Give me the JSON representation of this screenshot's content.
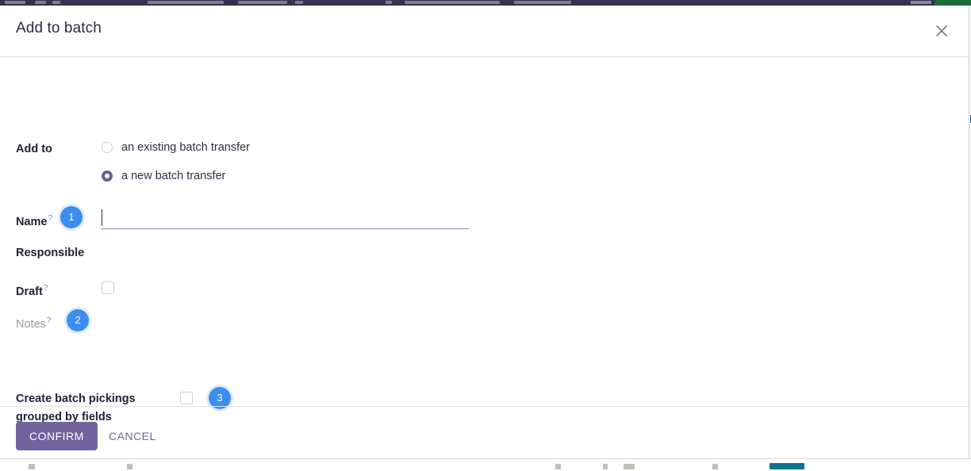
{
  "modal": {
    "title": "Add to batch",
    "close_icon": "close-icon"
  },
  "form": {
    "add_to": {
      "label": "Add to",
      "options": [
        {
          "label": "an existing batch transfer",
          "selected": false
        },
        {
          "label": "a new batch transfer",
          "selected": true
        }
      ]
    },
    "name": {
      "label": "Name",
      "help": "?",
      "value": "",
      "placeholder": ""
    },
    "responsible": {
      "label": "Responsible"
    },
    "draft": {
      "label": "Draft",
      "help": "?",
      "checked": false
    },
    "notes": {
      "label": "Notes",
      "help": "?"
    },
    "grouped_fields": {
      "label_line1": "Create batch pickings",
      "label_line2": "grouped by fields",
      "checked": false
    }
  },
  "tour_badges": [
    {
      "number": "1"
    },
    {
      "number": "2"
    },
    {
      "number": "3"
    }
  ],
  "footer": {
    "confirm_label": "CONFIRM",
    "cancel_label": "CANCEL"
  },
  "colors": {
    "badge_blue": "#3b8ef0",
    "radio_purple": "#6c5d95",
    "confirm_purple": "#71639e",
    "navbar_navy": "#33334d"
  }
}
